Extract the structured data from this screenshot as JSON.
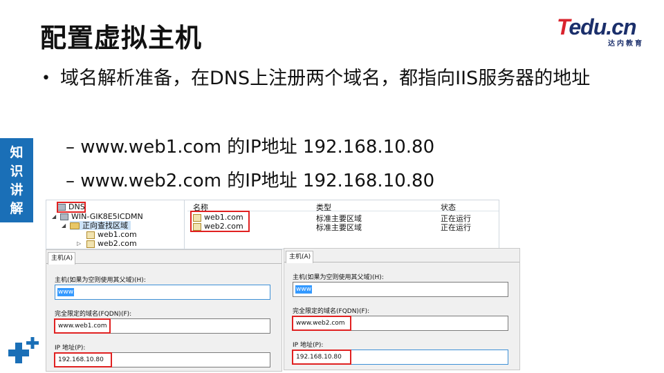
{
  "slide": {
    "title": "配置虚拟主机",
    "bullet": "域名解析准备，在DNS上注册两个域名，都指向IIS服务器的地址",
    "sub_items": [
      "– www.web1.com 的IP地址 192.168.10.80",
      "– www.web2.com 的IP地址 192.168.10.80"
    ],
    "side_tab": [
      "知",
      "识",
      "讲",
      "解"
    ]
  },
  "logo": {
    "text_t": "T",
    "text_rest": "edu.cn",
    "subtitle": "达内教育"
  },
  "colors": {
    "accent_blue": "#1a6fb7",
    "highlight_red": "#e02020",
    "logo_navy": "#1b2f6b",
    "logo_red": "#d9232d"
  },
  "dns_manager": {
    "tree": {
      "root": "DNS",
      "server": "WIN-GIK8E5ICDMN",
      "folder": "正向查找区域",
      "zones": [
        "web1.com",
        "web2.com"
      ]
    },
    "list": {
      "columns": [
        "名称",
        "类型",
        "状态"
      ],
      "rows": [
        {
          "name": "web1.com",
          "type": "标准主要区域",
          "status": "正在运行"
        },
        {
          "name": "web2.com",
          "type": "标准主要区域",
          "status": "正在运行"
        }
      ]
    }
  },
  "dialogs": [
    {
      "tab": "主机(A)",
      "host_label": "主机(如果为空则使用其父域)(H):",
      "host_value": "www",
      "fqdn_label": "完全限定的域名(FQDN)(F):",
      "fqdn_value": "www.web1.com",
      "ip_label": "IP 地址(P):",
      "ip_value": "192.168.10.80"
    },
    {
      "tab": "主机(A)",
      "host_label": "主机(如果为空则使用其父域)(H):",
      "host_value": "www",
      "fqdn_label": "完全限定的域名(FQDN)(F):",
      "fqdn_value": "www.web2.com",
      "ip_label": "IP 地址(P):",
      "ip_value": "192.168.10.80"
    }
  ]
}
